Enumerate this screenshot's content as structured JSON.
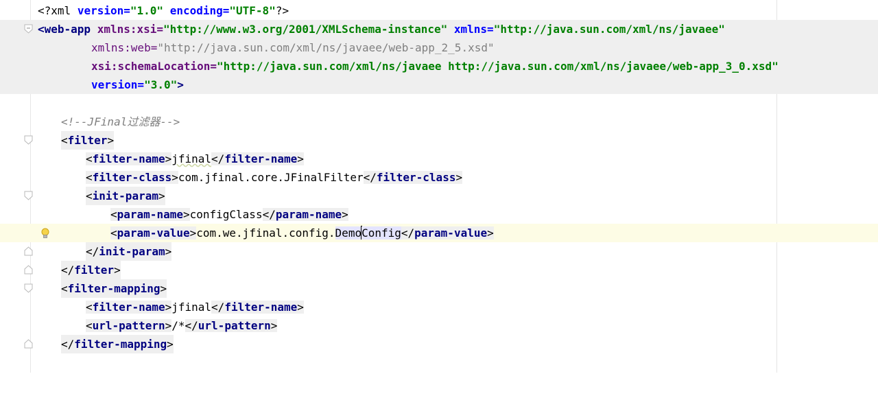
{
  "editor": {
    "lines": [
      {
        "id": "l1",
        "tokens": [
          "<?xml",
          "version=",
          "\"1.0\"",
          "encoding=",
          "\"UTF-8\"",
          "?>"
        ]
      },
      {
        "id": "l2",
        "tokens": [
          "<web-app",
          "xmlns:xsi=",
          "\"http://www.w3.org/2001/XMLSchema-instance\"",
          "xmlns=",
          "\"http://java.sun.com/xml/ns/javaee\""
        ]
      },
      {
        "id": "l3",
        "tokens": [
          "xmlns:web=",
          "\"http://java.sun.com/xml/ns/javaee/web-app_2_5.xsd\""
        ]
      },
      {
        "id": "l4",
        "tokens": [
          "xsi:schemaLocation=",
          "\"http://java.sun.com/xml/ns/javaee http://java.sun.com/xml/ns/javaee/web-app_3_0.xsd\""
        ]
      },
      {
        "id": "l5",
        "tokens": [
          "version=",
          "\"3.0\"",
          ">"
        ]
      },
      {
        "id": "l6",
        "tokens": [
          "<!--JFinal过滤器-->"
        ]
      },
      {
        "id": "l7",
        "tokens": [
          "<",
          "filter",
          ">"
        ]
      },
      {
        "id": "l8",
        "tokens": [
          "<",
          "filter-name",
          ">",
          "jfinal",
          "</",
          "filter-name",
          ">"
        ]
      },
      {
        "id": "l9",
        "tokens": [
          "<",
          "filter-class",
          ">",
          "com.jfinal.core.JFinalFilter",
          "</",
          "filter-class",
          ">"
        ]
      },
      {
        "id": "l10",
        "tokens": [
          "<",
          "init-param",
          ">"
        ]
      },
      {
        "id": "l11",
        "tokens": [
          "<",
          "param-name",
          ">",
          "configClass",
          "</",
          "param-name",
          ">"
        ]
      },
      {
        "id": "l12",
        "tokens": [
          "<",
          "param-value",
          ">",
          "com.we.jfinal.config.",
          "Demo",
          "Config",
          "</",
          "param-value",
          ">"
        ]
      },
      {
        "id": "l13",
        "tokens": [
          "</",
          "init-param",
          ">"
        ]
      },
      {
        "id": "l14",
        "tokens": [
          "</",
          "filter",
          ">"
        ]
      },
      {
        "id": "l15",
        "tokens": [
          "<",
          "filter-mapping",
          ">"
        ]
      },
      {
        "id": "l16",
        "tokens": [
          "<",
          "filter-name",
          ">",
          "jfinal",
          "</",
          "filter-name",
          ">"
        ]
      },
      {
        "id": "l17",
        "tokens": [
          "<",
          "url-pattern",
          ">",
          "/*",
          "</",
          "url-pattern",
          ">"
        ]
      },
      {
        "id": "l18",
        "tokens": [
          "</",
          "filter-mapping",
          ">"
        ]
      }
    ]
  },
  "colors": {
    "tag": "#000080",
    "attribute": "#0000ff",
    "namespace_attribute": "#660e7a",
    "value": "#008000",
    "comment": "#808080",
    "current_line": "#fdfce5",
    "highlighted_block": "#efefef"
  },
  "icons": {
    "fold": "fold-marker-icon",
    "intention": "lightbulb-icon"
  }
}
